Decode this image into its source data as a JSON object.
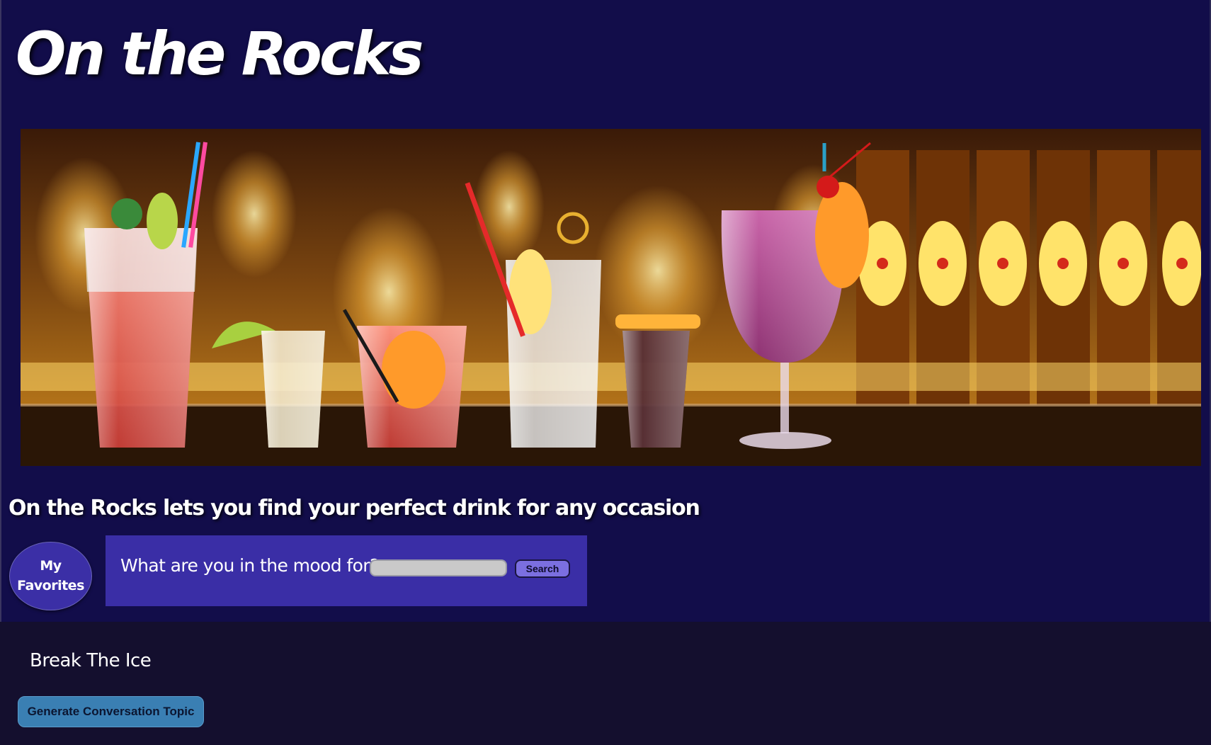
{
  "header": {
    "title": "On the Rocks"
  },
  "hero": {
    "alt_description": "bar-cocktails-banner"
  },
  "tagline": "On the Rocks lets you find your perfect drink for any occasion",
  "favorites": {
    "line1": "My",
    "line2": "Favorites"
  },
  "search": {
    "label": "What are you in the mood for?",
    "value": "",
    "placeholder": "",
    "button_label": "Search"
  },
  "ice": {
    "title": "Break The Ice",
    "button_label": "Generate Conversation Topic"
  },
  "colors": {
    "page_bg": "#120d4a",
    "panel_bg": "#3a2ea6",
    "footer_bg": "#140f2e",
    "topic_button": "#3a7fb3",
    "search_button": "#7b6fe0"
  }
}
